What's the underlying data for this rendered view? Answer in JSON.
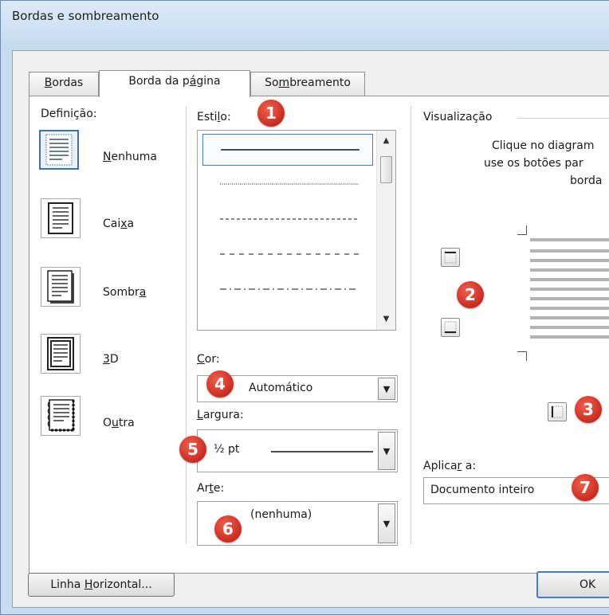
{
  "window": {
    "title": "Bordas e sombreamento"
  },
  "tabs": [
    {
      "label_pre": "",
      "label_u": "B",
      "label_post": "ordas"
    },
    {
      "label_pre": "Borda da p",
      "label_u": "á",
      "label_post": "gina"
    },
    {
      "label_pre": "So",
      "label_u": "m",
      "label_post": "breamento"
    }
  ],
  "definition": {
    "label": "Definição:",
    "items": [
      {
        "pre": "",
        "u": "N",
        "post": "enhuma",
        "icon": "page-none-icon"
      },
      {
        "pre": "Cai",
        "u": "x",
        "post": "a",
        "icon": "page-box-icon"
      },
      {
        "pre": "Sombr",
        "u": "a",
        "post": "",
        "icon": "page-shadow-icon"
      },
      {
        "pre": "",
        "u": "3",
        "post": "D",
        "icon": "page-3d-icon"
      },
      {
        "pre": "O",
        "u": "u",
        "post": "tra",
        "icon": "page-custom-icon"
      }
    ]
  },
  "style": {
    "label_pre": "Esti",
    "label_u": "l",
    "label_post": "o:"
  },
  "color": {
    "label_pre": "",
    "label_u": "C",
    "label_post": "or:",
    "value": "Automático"
  },
  "width": {
    "label_pre": "",
    "label_u": "L",
    "label_post": "argura:",
    "value": "½ pt"
  },
  "art": {
    "label_pre": "Ar",
    "label_u": "t",
    "label_post": "e:",
    "value": "(nenhuma)"
  },
  "preview": {
    "label": "Visualização",
    "hint_line1": "Clique no diagram",
    "hint_line2": "use os botões par",
    "hint_line3": "borda"
  },
  "apply": {
    "label_pre": "Aplica",
    "label_u": "r",
    "label_post": " a:",
    "value": "Documento inteiro"
  },
  "buttons": {
    "horizontal_pre": "Linha ",
    "horizontal_u": "H",
    "horizontal_post": "orizontal...",
    "ok": "OK"
  },
  "badges": [
    "1",
    "2",
    "3",
    "4",
    "5",
    "6",
    "7"
  ],
  "colors": {
    "badge": "#d2352a",
    "selection": "#3c7fd4",
    "title_bg": "#c9dcef"
  }
}
